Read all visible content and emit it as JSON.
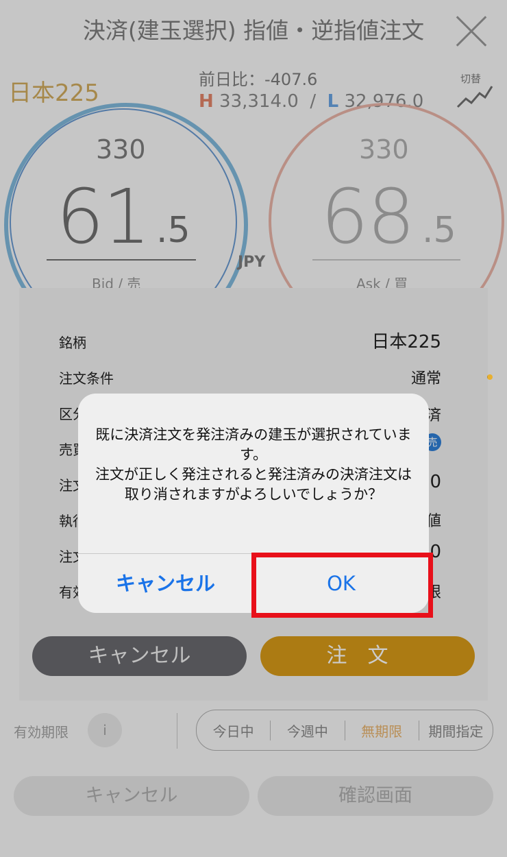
{
  "header": {
    "title": "決済(建玉選択) 指値・逆指値注文"
  },
  "ticker": {
    "symbol": "日本225",
    "change": "前日比：-407.6",
    "high_label": "H",
    "high": "33,314.0",
    "low_label": "L",
    "low": "32,976.0",
    "separator": "/",
    "switch_label": "切替"
  },
  "quote": {
    "bid_prefix": "330",
    "bid_main": "61",
    "bid_decimal": ".5",
    "bid_label": "Bid / 売",
    "ask_prefix": "330",
    "ask_main": "68",
    "ask_decimal": ".5",
    "ask_label": "Ask / 買",
    "currency": "JPY"
  },
  "validity": {
    "label": "有効期限",
    "info": "i",
    "options": [
      "今日中",
      "今週中",
      "無期限",
      "期間指定"
    ],
    "selected": "無期限"
  },
  "bottom_buttons": {
    "cancel": "キャンセル",
    "confirm": "確認画面"
  },
  "sheet": {
    "rows": [
      {
        "label": "銘柄",
        "value": "日本225"
      },
      {
        "label": "注文条件",
        "value": "通常"
      },
      {
        "label": "区分",
        "value": "済"
      },
      {
        "label": "売買",
        "value": "売"
      },
      {
        "label": "注文",
        "value": "0"
      },
      {
        "label": "執行",
        "value": "値"
      },
      {
        "label": "注文",
        "value": "0"
      },
      {
        "label": "有効",
        "value": "限"
      }
    ],
    "cancel_label": "キャンセル",
    "order_label": "注文"
  },
  "alert": {
    "message": "既に決済注文を発注済みの建玉が選択されています。\n注文が正しく発注されると発注済みの決済注文は取り消されますがよろしいでしょうか？",
    "cancel_label": "キャンセル",
    "ok_label": "OK"
  },
  "colors": {
    "accent_blue": "#1a73e8",
    "order_gold": "#d89a18",
    "highlight_red": "#e8101a"
  }
}
